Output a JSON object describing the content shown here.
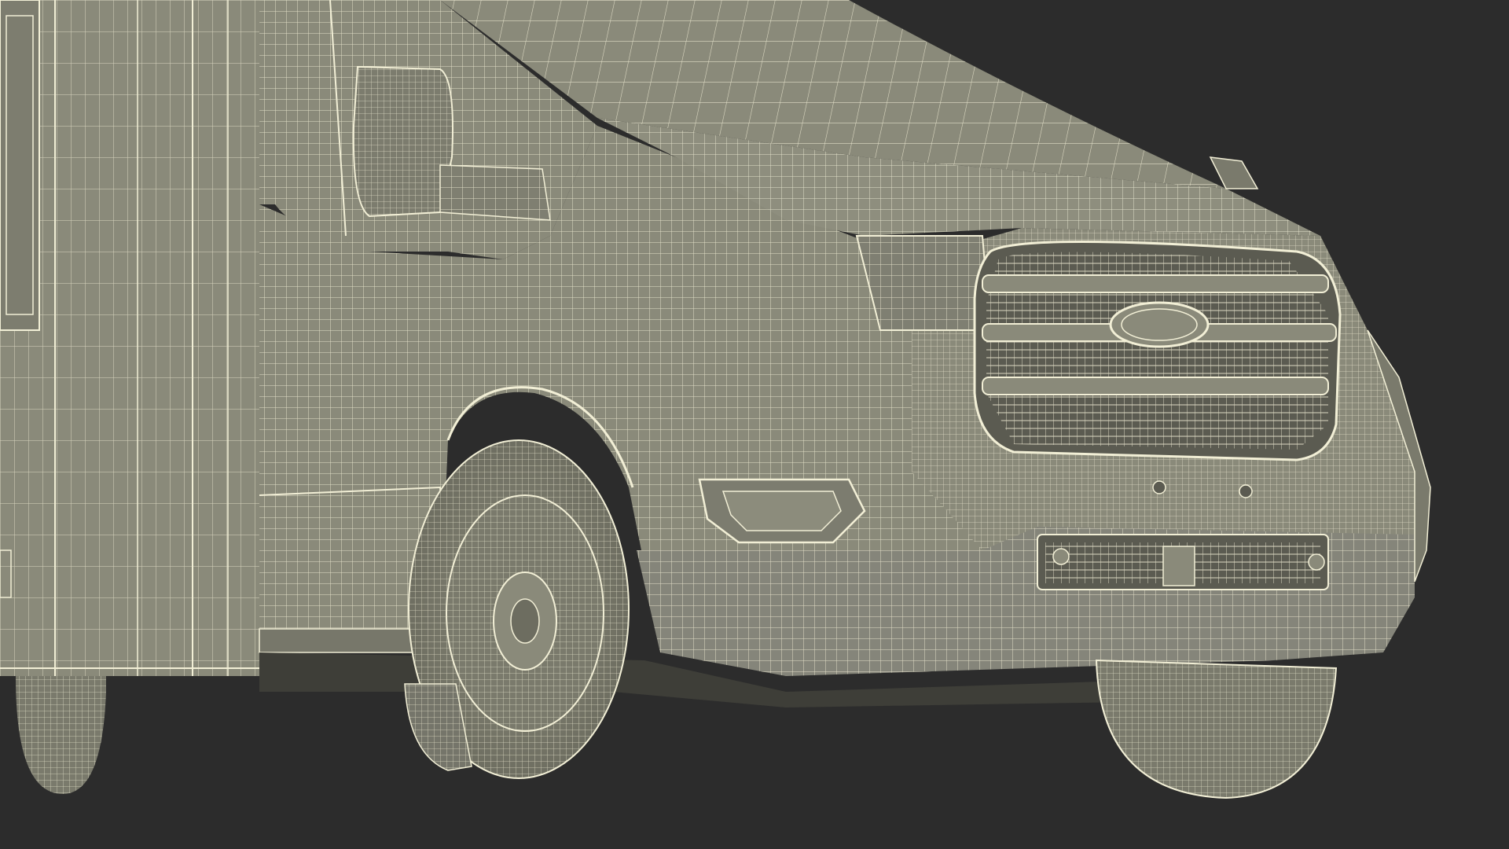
{
  "image": {
    "subject": "wireframe-render-van-front",
    "colors": {
      "background": "#2c2c2c",
      "surface": "#8a8a7a",
      "surface_dark": "#6f6f62",
      "surface_shadow": "#5a5a50",
      "wire": "#f2efd6",
      "cavity": "#4a4a42"
    }
  }
}
